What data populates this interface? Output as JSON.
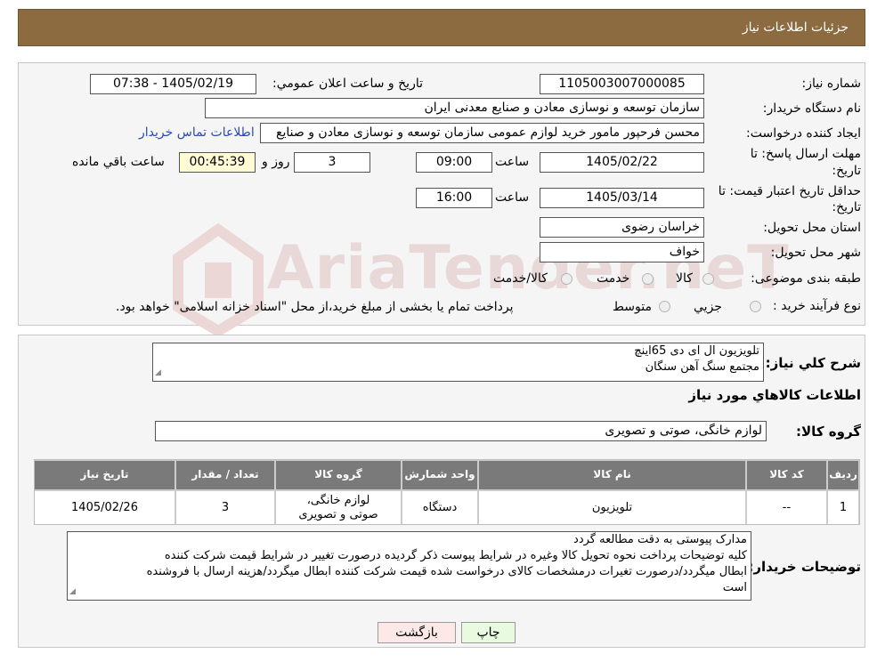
{
  "header": {
    "title": "جزئیات اطلاعات نیاز"
  },
  "form": {
    "need_number_label": "شماره نیاز:",
    "need_number": "1105003007000085",
    "announce_label": "تاریخ و ساعت اعلان عمومي:",
    "announce_value": "1405/02/19 - 07:38",
    "buyer_org_label": "نام دستگاه خريدار:",
    "buyer_org": "سازمان توسعه و نوسازی معادن و صنایع معدنی ایران",
    "requester_label": "ايجاد کننده درخواست:",
    "requester": "محسن فرحپور مامور خرید لوازم عمومی سازمان توسعه و نوسازی معادن و صنایع",
    "contact_link": "اطلاعات تماس خريدار",
    "deadline_label_1": "مهلت ارسال پاسخ: تا",
    "deadline_label_2": "تاريخ:",
    "deadline_date": "1405/02/22",
    "time_label": "ساعت",
    "deadline_time": "09:00",
    "days_value": "3",
    "days_label": "روز و",
    "remaining_time": "00:45:39",
    "remaining_label": "ساعت باقي مانده",
    "price_valid_label_1": "حداقل تاريخ اعتبار قيمت: تا",
    "price_valid_label_2": "تاريخ:",
    "price_valid_date": "1405/03/14",
    "price_valid_time": "16:00",
    "province_label": "استان محل تحويل:",
    "province": "خراسان رضوی",
    "city_label": "شهر محل تحويل:",
    "city": "خواف",
    "category_label": "طبقه بندی موضوعی:",
    "category_options": [
      "کالا",
      "خدمت",
      "کالا/خدمت"
    ],
    "process_label": "نوع فرآيند خريد :",
    "process_options": [
      "جزيي",
      "متوسط"
    ],
    "process_note": "پرداخت تمام یا بخشی از مبلغ خرید،از محل \"اسناد خزانه اسلامی\" خواهد بود."
  },
  "summary": {
    "label": "شرح کلي نياز:",
    "line1": "تلویزیون ال ای دی 65اینچ",
    "line2": "مجتمع سنگ آهن سنگان"
  },
  "goods": {
    "section_title": "اطلاعات کالاهاي مورد نياز",
    "group_label": "گروه کالا:",
    "group_value": "لوازم خانگی، صوتی و تصویری",
    "columns": [
      "رديف",
      "کد کالا",
      "نام کالا",
      "واحد شمارش",
      "گروه کالا",
      "تعداد / مقدار",
      "تاريخ نياز"
    ],
    "rows": [
      [
        "1",
        "--",
        "تلویزیون",
        "دستگاه",
        "لوازم خانگی، صوتی و تصویری",
        "3",
        "1405/02/26"
      ]
    ]
  },
  "buyer_notes": {
    "label": "توضيحات خريدار:",
    "line1": "مدارک پیوستی به دقت مطالعه گردد",
    "line2": "کلیه توضیحات پرداخت نحوه تحویل کالا وغیره در شرایط پیوست ذکر گردیده درصورت تغییر در شرایط  قیمت شرکت کننده",
    "line3": "ابطال میگردد/درصورت تغیرات درمشخصات کالای درخواست شده قیمت شرکت کننده ابطال میگردد/هزینه ارسال با فروشنده",
    "line4": "است"
  },
  "buttons": {
    "print": "چاپ",
    "back": "بازگشت"
  },
  "watermark": "AriaTender.neT",
  "colors": {
    "header_bg": "#8b6b3f",
    "table_header": "#7a7a7a",
    "link": "#2a49b3",
    "back_button": "#fde8e8",
    "print_button": "#e8fbe0"
  }
}
